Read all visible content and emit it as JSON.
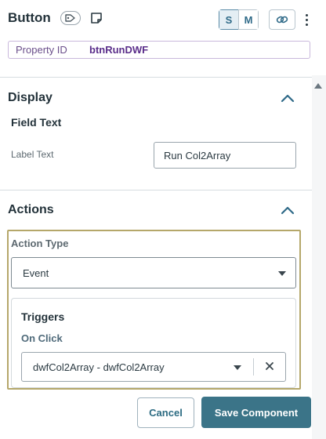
{
  "header": {
    "title": "Button",
    "tag_icon": "tag-icon",
    "note_icon": "note-icon",
    "size_options": [
      "S",
      "M"
    ],
    "selected_size": "S",
    "link_icon": "link-icon",
    "menu_icon": "kebab-menu-icon"
  },
  "property": {
    "label": "Property ID",
    "value": "btnRunDWF"
  },
  "display": {
    "title": "Display",
    "field_text_heading": "Field Text",
    "label_text_label": "Label Text",
    "label_text_value": "Run Col2Array"
  },
  "actions": {
    "title": "Actions",
    "action_type_label": "Action Type",
    "action_type_value": "Event",
    "triggers_heading": "Triggers",
    "on_click_label": "On Click",
    "on_click_value": "dwfCol2Array - dwfCol2Array"
  },
  "footer": {
    "cancel_label": "Cancel",
    "save_label": "Save Component"
  },
  "colors": {
    "accent": "#3b7488",
    "highlight_border": "#b5a76a",
    "property_border": "#c9b8dc"
  }
}
